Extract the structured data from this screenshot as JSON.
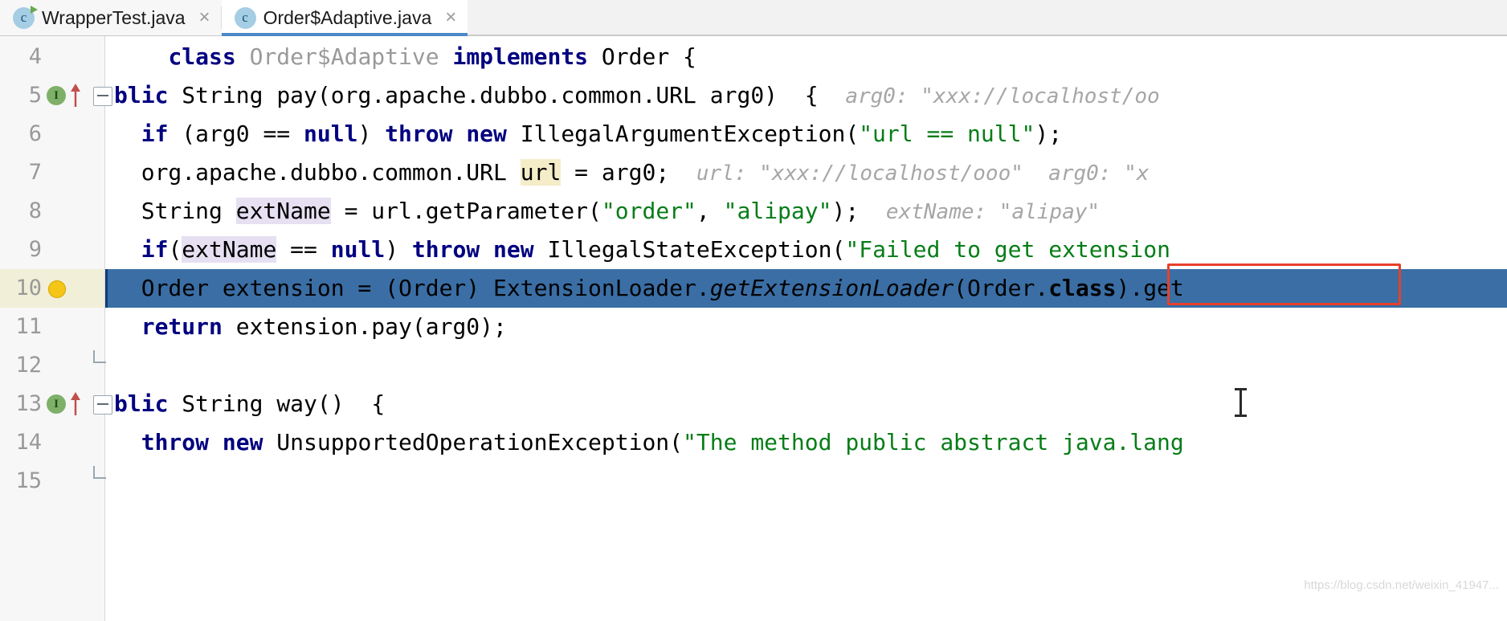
{
  "window": {
    "app": "IntelliJ IDEA Java Editor"
  },
  "tabs": [
    {
      "label": "WrapperTest.java",
      "icon": "java-class-icon",
      "close": "×",
      "active": false,
      "icon_letter": "c"
    },
    {
      "label": "Order$Adaptive.java",
      "icon": "java-class-icon",
      "close": "×",
      "active": true,
      "icon_letter": "c"
    }
  ],
  "editor": {
    "current_line": 10,
    "accent_color": "#4a88c7",
    "selection_color": "#3a6ea5",
    "annotation_box_color": "#e8402a",
    "keyword_color": "#000080",
    "string_color": "#067d17",
    "hint_color": "#a6a6a6",
    "lines": [
      {
        "number": "4",
        "gutter": "none",
        "segments": [
          {
            "t": "    ",
            "c": "plain"
          },
          {
            "t": "class ",
            "c": "kw"
          },
          {
            "t": "Order$Adaptive ",
            "c": "dim"
          },
          {
            "t": "implements ",
            "c": "kw"
          },
          {
            "t": "Order {",
            "c": "plain"
          }
        ]
      },
      {
        "number": "5",
        "gutter": "implements-marker",
        "fold": "start",
        "segments": [
          {
            "t": "blic ",
            "c": "kw"
          },
          {
            "t": "String ",
            "c": "plain"
          },
          {
            "t": "pay(org.apache.dubbo.common.URL arg0)  {  ",
            "c": "plain"
          },
          {
            "t": "arg0: \"xxx://localhost/oo",
            "c": "hint"
          }
        ]
      },
      {
        "number": "6",
        "gutter": "none",
        "segments": [
          {
            "t": "  ",
            "c": "plain"
          },
          {
            "t": "if ",
            "c": "kw"
          },
          {
            "t": "(arg0 == ",
            "c": "plain"
          },
          {
            "t": "null",
            "c": "kw"
          },
          {
            "t": ") ",
            "c": "plain"
          },
          {
            "t": "throw new ",
            "c": "kw"
          },
          {
            "t": "IllegalArgumentException(",
            "c": "plain"
          },
          {
            "t": "\"url == null\"",
            "c": "str"
          },
          {
            "t": ");",
            "c": "plain"
          }
        ]
      },
      {
        "number": "7",
        "gutter": "none",
        "segments": [
          {
            "t": "  org.apache.dubbo.common.URL ",
            "c": "plain"
          },
          {
            "t": "url",
            "c": "hl-url"
          },
          {
            "t": " = arg0;  ",
            "c": "plain"
          },
          {
            "t": "url: \"xxx://localhost/ooo\"  arg0: \"x",
            "c": "hint"
          }
        ]
      },
      {
        "number": "8",
        "gutter": "none",
        "segments": [
          {
            "t": "  String ",
            "c": "plain"
          },
          {
            "t": "extName",
            "c": "hl-ext"
          },
          {
            "t": " = url.getParameter(",
            "c": "plain"
          },
          {
            "t": "\"order\"",
            "c": "str"
          },
          {
            "t": ", ",
            "c": "plain"
          },
          {
            "t": "\"alipay\"",
            "c": "str"
          },
          {
            "t": ");  ",
            "c": "plain"
          },
          {
            "t": "extName: \"alipay\"",
            "c": "hint"
          }
        ]
      },
      {
        "number": "9",
        "gutter": "none",
        "segments": [
          {
            "t": "  ",
            "c": "plain"
          },
          {
            "t": "if",
            "c": "kw"
          },
          {
            "t": "(",
            "c": "plain"
          },
          {
            "t": "extName",
            "c": "hl-ext"
          },
          {
            "t": " == ",
            "c": "plain"
          },
          {
            "t": "null",
            "c": "kw"
          },
          {
            "t": ") ",
            "c": "plain"
          },
          {
            "t": "throw new ",
            "c": "kw"
          },
          {
            "t": "IllegalStateException(",
            "c": "plain"
          },
          {
            "t": "\"Failed to get extension",
            "c": "str"
          }
        ]
      },
      {
        "number": "10",
        "gutter": "lightbulb",
        "current": true,
        "segments": [
          {
            "t": "  Order extension = (Order) ExtensionLoader.",
            "c": "plain"
          },
          {
            "t": "getExtensionLoader",
            "c": "ital"
          },
          {
            "t": "(Order.",
            "c": "plain"
          },
          {
            "t": "class",
            "c": "kw-sel"
          },
          {
            "t": ").get",
            "c": "plain"
          }
        ]
      },
      {
        "number": "11",
        "gutter": "none",
        "segments": [
          {
            "t": "  ",
            "c": "plain"
          },
          {
            "t": "return ",
            "c": "kw"
          },
          {
            "t": "extension.pay(arg0);",
            "c": "plain"
          }
        ]
      },
      {
        "number": "12",
        "gutter": "none",
        "fold": "end",
        "segments": []
      },
      {
        "number": "13",
        "gutter": "implements-marker",
        "fold": "start",
        "segments": [
          {
            "t": "blic ",
            "c": "kw"
          },
          {
            "t": "String ",
            "c": "plain"
          },
          {
            "t": "way()  {",
            "c": "plain"
          }
        ]
      },
      {
        "number": "14",
        "gutter": "none",
        "segments": [
          {
            "t": "  ",
            "c": "plain"
          },
          {
            "t": "throw new ",
            "c": "kw"
          },
          {
            "t": "UnsupportedOperationException(",
            "c": "plain"
          },
          {
            "t": "\"The method public abstract java.lang",
            "c": "str"
          }
        ]
      },
      {
        "number": "15",
        "gutter": "none",
        "fold": "end",
        "segments": []
      }
    ]
  },
  "annotations": {
    "hint_box_target": "extName: \"alipay\""
  },
  "watermark": "https://blog.csdn.net/weixin_41947..."
}
